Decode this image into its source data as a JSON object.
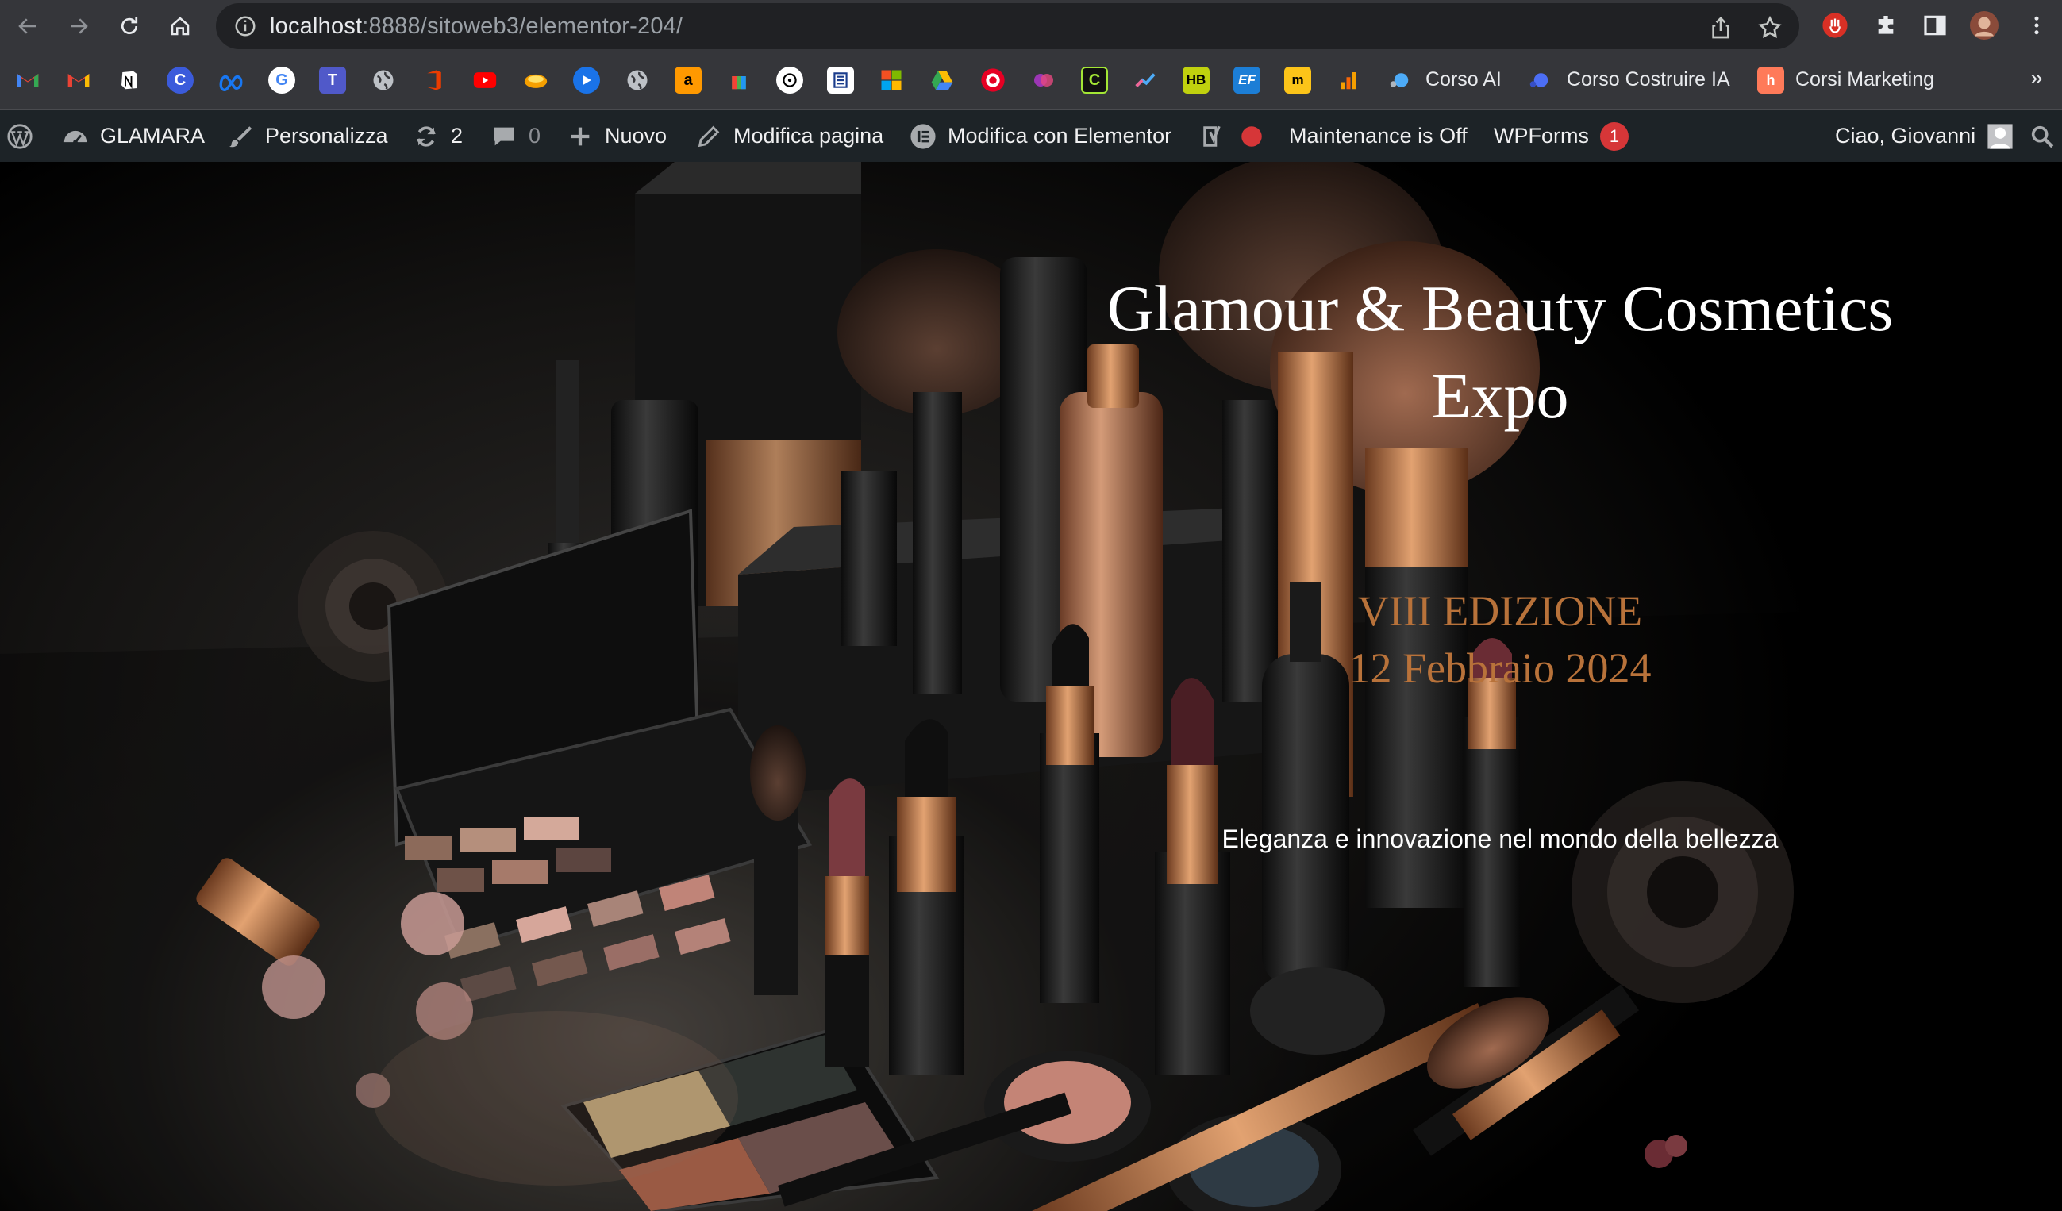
{
  "browser": {
    "url_host": "localhost",
    "url_rest": ":8888/sitoweb3/elementor-204/"
  },
  "bookmarks": {
    "icons": [
      "gmail-icon",
      "gmail-icon",
      "notion-icon",
      "c-icon",
      "meta-icon",
      "google-icon",
      "teams-icon",
      "globe-icon",
      "office-icon",
      "youtube-icon",
      "deal-icon",
      "play-icon",
      "globe-icon",
      "amazon-icon",
      "gift-icon",
      "chatgpt-icon",
      "book-icon",
      "microsoft-icon",
      "drive-icon",
      "pinterest-icon",
      "circle-icon",
      "c-icon",
      "chart-icon",
      "hb-icon",
      "ef-icon",
      "m-icon",
      "bar-chart-icon"
    ],
    "items": [
      {
        "label": "Corso AI"
      },
      {
        "label": "Corso Costruire IA"
      },
      {
        "label": "Corsi Marketing"
      }
    ],
    "more": "»"
  },
  "wpbar": {
    "site_name": "GLAMARA",
    "customize": "Personalizza",
    "updates_count": "2",
    "comments_count": "0",
    "new": "Nuovo",
    "edit_page": "Modifica pagina",
    "edit_elementor": "Modifica con Elementor",
    "maintenance": "Maintenance is Off",
    "wpforms": "WPForms",
    "wpforms_badge": "1",
    "greeting": "Ciao, Giovanni"
  },
  "hero": {
    "title_line1": "Glamour & Beauty Cosmetics",
    "title_line2": "Expo",
    "edition": "VIII EDIZIONE",
    "date": "12 Febbraio 2024",
    "tagline": "Eleganza e innovazione nel mondo della bellezza"
  },
  "colors": {
    "accent_copper": "#b8723a",
    "wp_badge": "#d63638",
    "chrome_bg": "#35363a",
    "wpbar_bg": "#1d2327"
  }
}
